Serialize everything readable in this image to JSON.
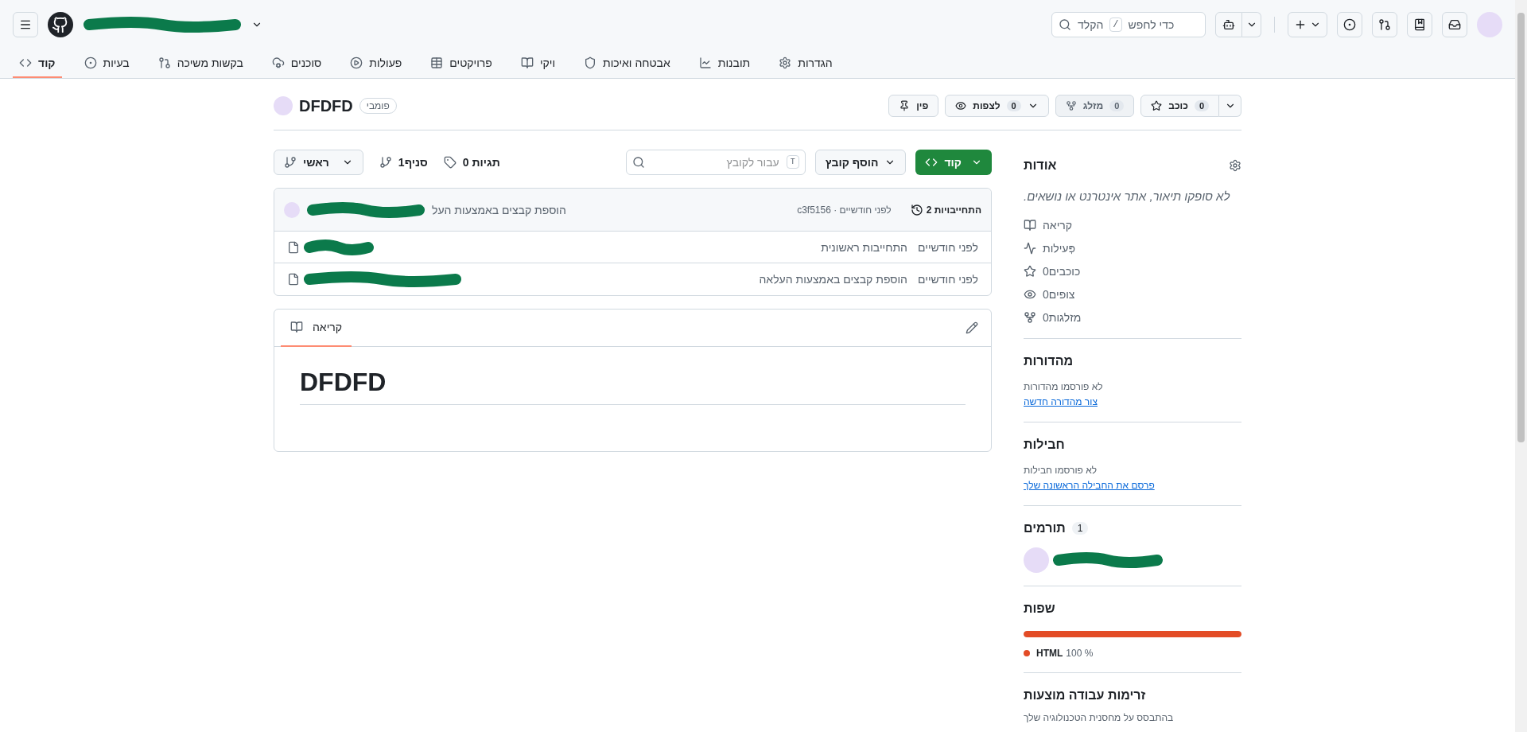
{
  "header": {
    "search": {
      "hint": "כדי לחפש",
      "key": "/",
      "hint_end": "הקלד"
    },
    "nav_tabs": [
      {
        "label": "הגדרות",
        "selected": false
      },
      {
        "label": "תובנות",
        "selected": false
      },
      {
        "label": "אבטחה ואיכות",
        "selected": false
      },
      {
        "label": "ויקי",
        "selected": false
      },
      {
        "label": "פרויקטים",
        "selected": false
      },
      {
        "label": "פעולות",
        "selected": false
      },
      {
        "label": "סוכנים",
        "selected": false
      },
      {
        "label": "בקשות משיכה",
        "selected": false
      },
      {
        "label": "בעיות",
        "selected": false
      },
      {
        "label": "קוד",
        "selected": true
      }
    ]
  },
  "repo": {
    "name": "DFDFD",
    "visibility": "פומבי",
    "actions": [
      {
        "kind": "star",
        "label": "כוכב",
        "count": "0",
        "disabled": false
      },
      {
        "kind": "fork",
        "label": "מזלג",
        "count": "0",
        "disabled": true
      },
      {
        "kind": "watch",
        "label": "לצפות",
        "count": "0",
        "disabled": false
      },
      {
        "kind": "pin",
        "label": "פין",
        "disabled": false
      }
    ]
  },
  "toolbar": {
    "branch": "ראשי",
    "branches": "1סניף",
    "tags": "0 תגיות",
    "file_search": {
      "placeholder": "עבור לקובץ",
      "key": "T"
    },
    "add_file": "הוסף קובץ",
    "code": "קוד"
  },
  "commits": {
    "message": "הוספת קבצים באמצעות העל",
    "hash_time": "c3f5156 · לפני חודשיים",
    "count": "2 התחייבויות"
  },
  "files": [
    {
      "message": "התחייבות ראשונית",
      "time": "לפני חודשיים"
    },
    {
      "message": "הוספת קבצים באמצעות העלאה",
      "time": "לפני חודשיים"
    }
  ],
  "readme": {
    "tab": "קריאה",
    "heading": "DFDFD"
  },
  "sidebar": {
    "about": {
      "title": "אודות",
      "description": "לא סופקו תיאור, אתר אינטרנט או נושאים.",
      "links": [
        {
          "kind": "readme",
          "label": "קריאה"
        },
        {
          "kind": "activity",
          "label": "פְּעילות"
        },
        {
          "kind": "stars",
          "label": "0כוכבים"
        },
        {
          "kind": "watchers",
          "label": "0צופים"
        },
        {
          "kind": "forks",
          "label": "0מזלגות"
        }
      ]
    },
    "releases": {
      "title": "מהדורות",
      "note": "לא פורסמו מהדורות",
      "link": "צור מהדורה חדשה"
    },
    "packages": {
      "title": "חבילות",
      "note": "לא פורסמו חבילות",
      "link": "פרסם את החבילה הראשונה שלך"
    },
    "contributors": {
      "title": "תורמים",
      "count": "1"
    },
    "languages": {
      "title": "שפות",
      "items": [
        {
          "name": "HTML",
          "share": "100 %",
          "color": "#e34c26",
          "level": 1
        }
      ]
    },
    "workflows": {
      "title": "זרימות עבודה מוצעות",
      "note": "בהתבסס על מחסנית הטכנולוגיה שלך"
    }
  }
}
